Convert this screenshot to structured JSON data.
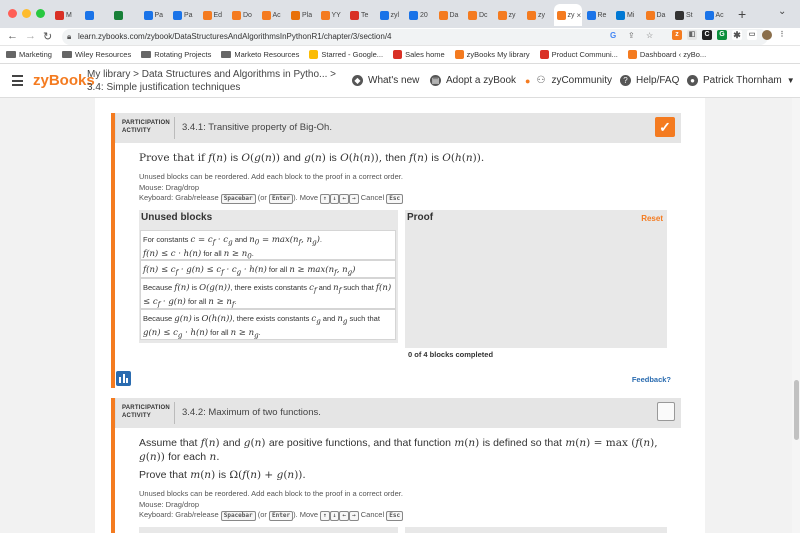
{
  "browser": {
    "tabs": [
      {
        "label": "M",
        "color": "#d93025"
      },
      {
        "label": "",
        "color": "#1a73e8"
      },
      {
        "label": "",
        "color": "#188038"
      },
      {
        "label": "Pa",
        "color": "#1a73e8"
      },
      {
        "label": "Pa",
        "color": "#1a73e8"
      },
      {
        "label": "Ed",
        "color": "#f47b20"
      },
      {
        "label": "Do",
        "color": "#f47b20"
      },
      {
        "label": "Ac",
        "color": "#f47b20"
      },
      {
        "label": "Pla",
        "color": "#e8710a"
      },
      {
        "label": "YY",
        "color": "#f47b20"
      },
      {
        "label": "Te",
        "color": "#d93025"
      },
      {
        "label": "zyl",
        "color": "#1a73e8"
      },
      {
        "label": "20",
        "color": "#1a73e8"
      },
      {
        "label": "Da",
        "color": "#f47b20"
      },
      {
        "label": "Dc",
        "color": "#f47b20"
      },
      {
        "label": "zy",
        "color": "#f47b20"
      },
      {
        "label": "zy",
        "color": "#f47b20"
      },
      {
        "label": "zy",
        "color": "#f47b20",
        "active": true
      },
      {
        "label": "Re",
        "color": "#1a73e8"
      },
      {
        "label": "Mi",
        "color": "#0078d4"
      },
      {
        "label": "Da",
        "color": "#f47b20"
      },
      {
        "label": "St",
        "color": "#333333"
      },
      {
        "label": "Ac",
        "color": "#1a73e8"
      }
    ],
    "url": "learn.zybooks.com/zybook/DataStructuresAndAlgorithmsInPythonR1/chapter/3/section/4",
    "bookmarks": [
      {
        "label": "Marketing",
        "kind": "folder"
      },
      {
        "label": "Wiley Resources",
        "kind": "folder"
      },
      {
        "label": "Rotating Projects",
        "kind": "folder"
      },
      {
        "label": "Marketo Resources",
        "kind": "folder"
      },
      {
        "label": "Starred - Google...",
        "kind": "drive"
      },
      {
        "label": "Sales home",
        "kind": "site"
      },
      {
        "label": "zyBooks My library",
        "kind": "zy"
      },
      {
        "label": "Product Communi...",
        "kind": "site"
      },
      {
        "label": "Dashboard ‹ zyBo...",
        "kind": "zy"
      }
    ]
  },
  "header": {
    "logo": "zyBooks",
    "breadcrumb_line1": "My library > Data Structures and Algorithms in Pytho... >",
    "breadcrumb_line2": "3.4: Simple justification techniques",
    "whats_new": "What's new",
    "adopt": "Adopt a zyBook",
    "community": "zyCommunity",
    "help": "Help/FAQ",
    "user": "Patrick Thornham",
    "brand_color": "#f47b20"
  },
  "activity1": {
    "label_line1": "PARTICIPATION",
    "label_line2": "ACTIVITY",
    "title": "3.4.1: Transitive property of Big-Oh.",
    "completed": true,
    "prompt": "Prove that if f(n) is O(g(n)) and g(n) is O(h(n)), then f(n) is O(h(n)).",
    "instr1": "Unused blocks can be reordered. Add each block to the proof in a correct order.",
    "instr2": "Mouse: Drag/drop",
    "unused_title": "Unused blocks",
    "proof_title": "Proof",
    "reset": "Reset",
    "blocks": [
      "For constants c = c_f · c_g and n0 = max(n_f, n_g). f(n) ≤ c · h(n) for all n ≥ n0.",
      "f(n) ≤ c_f · g(n) ≤ c_f · c_g · h(n) for all n ≥ max(n_f, n_g)",
      "Because f(n) is O(g(n)), there exists constants c_f and n_f such that f(n) ≤ c_f · g(n) for all n ≥ n_f.",
      "Because g(n) is O(h(n)), there exists constants c_g and n_g such that g(n) ≤ c_g · h(n) for all n ≥ n_g."
    ],
    "progress": "0 of 4 blocks completed",
    "feedback": "Feedback?"
  },
  "activity2": {
    "label_line1": "PARTICIPATION",
    "label_line2": "ACTIVITY",
    "title": "3.4.2: Maximum of two functions.",
    "completed": false,
    "prompt1": "Assume that f(n) and g(n) are positive functions, and that function m(n) is defined so that m(n) = max(f(n), g(n)) for each n.",
    "prompt2": "Prove that m(n) is Ω(f(n) + g(n)).",
    "instr1": "Unused blocks can be reordered. Add each block to the proof in a correct order.",
    "instr2": "Mouse: Drag/drop"
  },
  "keyboard_hint": {
    "prefix": "Keyboard: Grab/release",
    "spacebar": "Spacebar",
    "or": "(or",
    "enter": "Enter",
    "move": "). Move",
    "arrows": [
      "↑",
      "↓",
      "←",
      "→"
    ],
    "cancel": "Cancel",
    "esc": "Esc"
  }
}
